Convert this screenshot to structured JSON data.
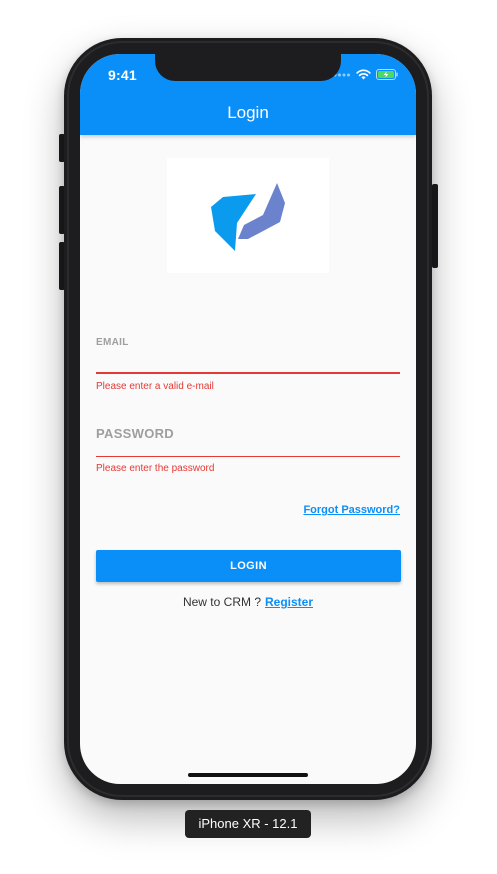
{
  "status_bar": {
    "time": "9:41"
  },
  "header": {
    "title": "Login"
  },
  "logo": {
    "icon": "brand-logo",
    "colors": [
      "#0a9bef",
      "#6a83cc"
    ]
  },
  "form": {
    "email": {
      "label": "EMAIL",
      "value": "",
      "error": "Please enter a valid e-mail"
    },
    "password": {
      "label": "PASSWORD",
      "value": "",
      "error": "Please enter the password"
    },
    "forgot_label": "Forgot Password?",
    "login_label": "LOGIN"
  },
  "register": {
    "prompt": "New to CRM ?",
    "link_label": "Register"
  },
  "device": {
    "label": "iPhone XR - 12.1"
  },
  "colors": {
    "primary": "#0a8ff8",
    "error": "#e53935",
    "background": "#fafafa",
    "muted_label": "#9e9e9e"
  }
}
